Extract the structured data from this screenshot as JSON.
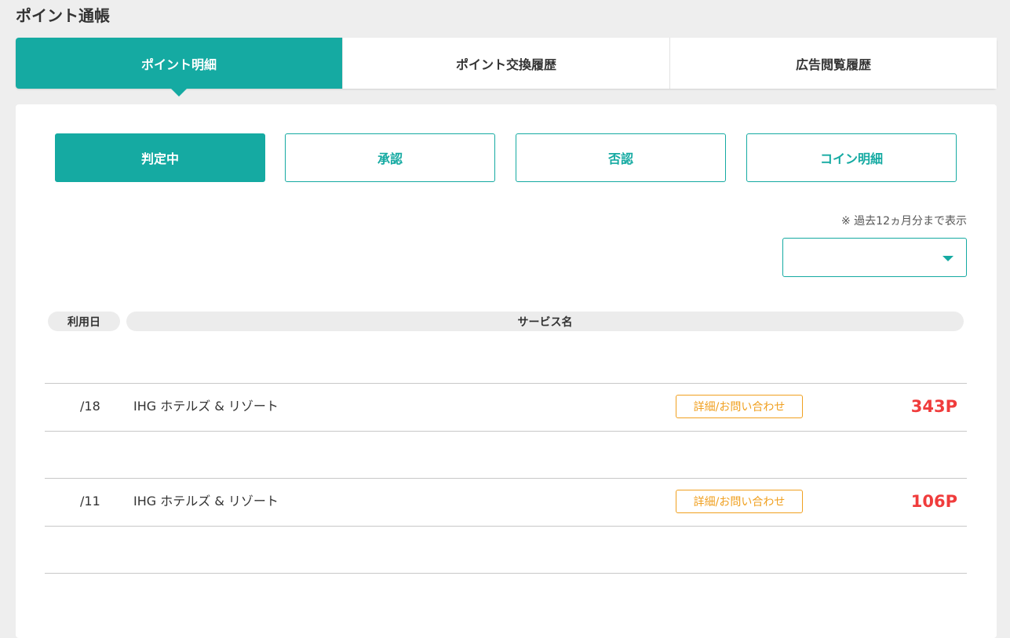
{
  "page": {
    "title": "ポイント通帳"
  },
  "main_tabs": [
    {
      "label": "ポイント明細",
      "active": true
    },
    {
      "label": "ポイント交換履歴",
      "active": false
    },
    {
      "label": "広告閲覧履歴",
      "active": false
    }
  ],
  "sub_tabs": [
    {
      "label": "判定中",
      "active": true
    },
    {
      "label": "承認",
      "active": false
    },
    {
      "label": "否認",
      "active": false
    },
    {
      "label": "コイン明細",
      "active": false
    }
  ],
  "period": {
    "note": "※ 過去12ヵ月分まで表示",
    "selected": ""
  },
  "table": {
    "headers": {
      "date": "利用日",
      "service": "サービス名"
    },
    "rows": [
      {
        "date": "/18",
        "service": "IHG ホテルズ & リゾート",
        "detail_label": "詳細/お問い合わせ",
        "points": "343P"
      },
      {
        "date": "/11",
        "service": "IHG ホテルズ & リゾート",
        "detail_label": "詳細/お問い合わせ",
        "points": "106P"
      }
    ]
  },
  "colors": {
    "accent": "#15aaa2",
    "detail_border": "#f0a020",
    "points": "#f03c3c",
    "background": "#eeeeee"
  },
  "icons": {
    "select_caret": "caret-down-icon"
  }
}
